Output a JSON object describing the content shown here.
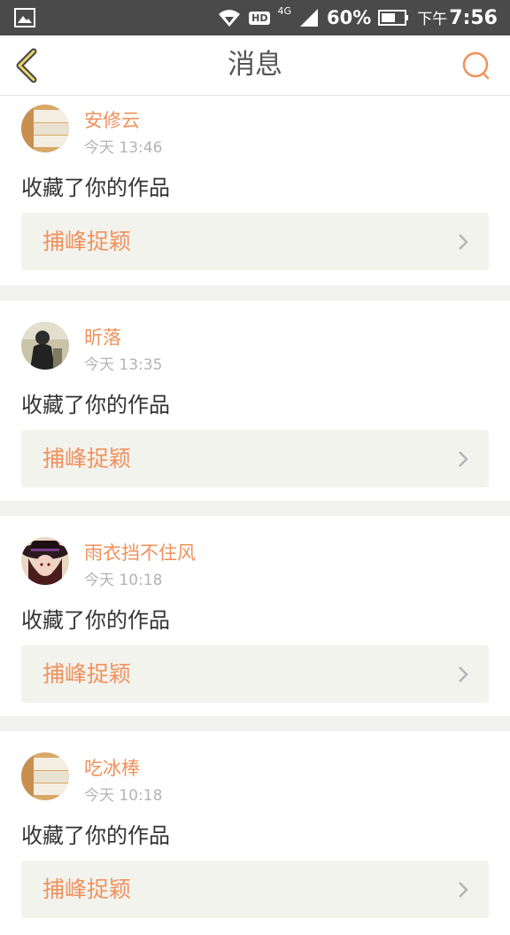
{
  "status_bar": {
    "network": "4G",
    "hd": "HD",
    "sim": "2",
    "battery_percent": "60%",
    "time_prefix": "下午",
    "time": "7:56",
    "icons": [
      "image-icon",
      "wifi-icon",
      "signal-icon",
      "battery-icon"
    ]
  },
  "header": {
    "title": "消息",
    "back_icon": "chevron-left-icon",
    "search_icon": "search-icon",
    "accent_color": "#f0915c"
  },
  "messages": [
    {
      "username": "安修云",
      "time": "今天 13:46",
      "action": "收藏了你的作品",
      "work_title": "捕峰捉颖",
      "avatar": "book-stack-avatar"
    },
    {
      "username": "昕落",
      "time": "今天 13:35",
      "action": "收藏了你的作品",
      "work_title": "捕峰捉颖",
      "avatar": "person-photo-avatar"
    },
    {
      "username": "雨衣挡不住风",
      "time": "今天 10:18",
      "action": "收藏了你的作品",
      "work_title": "捕峰捉颖",
      "avatar": "hat-girl-avatar"
    },
    {
      "username": "吃冰棒",
      "time": "今天 10:18",
      "action": "收藏了你的作品",
      "work_title": "捕峰捉颖",
      "avatar": "book-stack-avatar"
    }
  ]
}
